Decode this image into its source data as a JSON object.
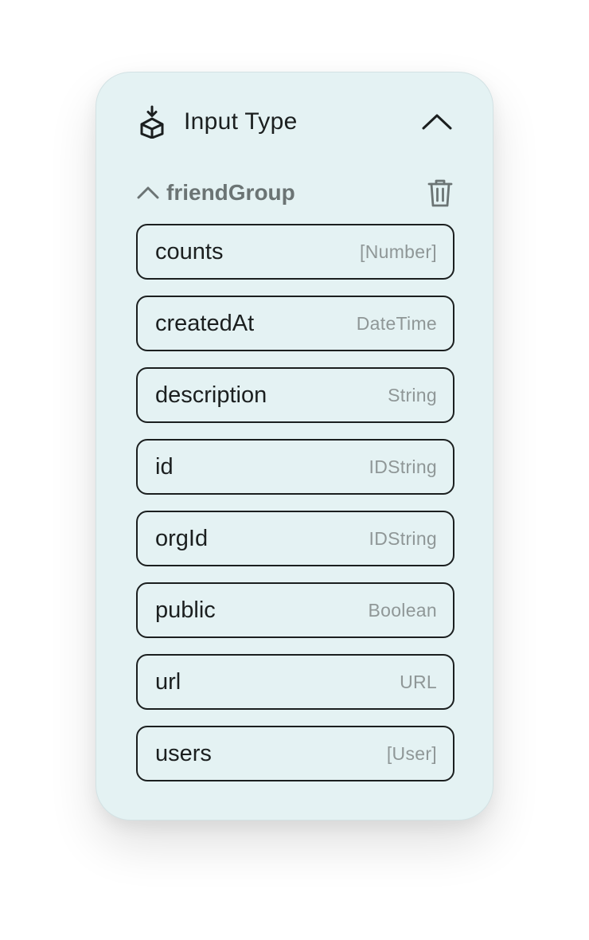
{
  "panel": {
    "title": "Input Type",
    "icon": "package-download-icon"
  },
  "group": {
    "name": "friendGroup",
    "expanded": true
  },
  "fields": [
    {
      "name": "counts",
      "type": "[Number]"
    },
    {
      "name": "createdAt",
      "type": "DateTime"
    },
    {
      "name": "description",
      "type": "String"
    },
    {
      "name": "id",
      "type": "IDString"
    },
    {
      "name": "orgId",
      "type": "IDString"
    },
    {
      "name": "public",
      "type": "Boolean"
    },
    {
      "name": "url",
      "type": "URL"
    },
    {
      "name": "users",
      "type": "[User]"
    }
  ],
  "colors": {
    "panel_bg": "#e4f2f3",
    "text": "#1b1f1f",
    "muted": "#8f9797",
    "group_label": "#6b7474"
  }
}
